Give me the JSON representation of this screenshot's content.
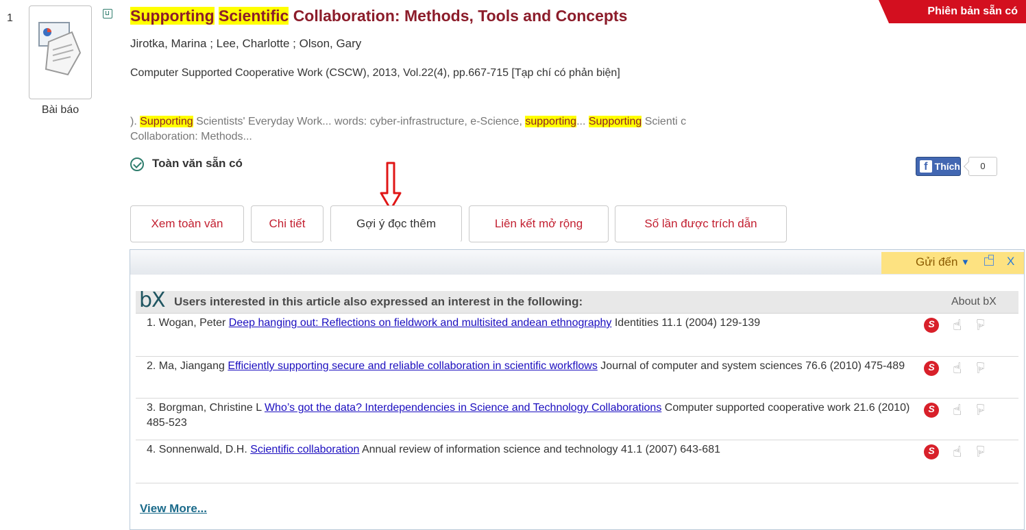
{
  "result": {
    "number": "1",
    "type_label": "Bài báo",
    "title_hl1": "Supporting",
    "title_hl2": "Scientific",
    "title_rest": "Collaboration: Methods, Tools and Concepts",
    "availability_badge": "Phiên bản sẵn có",
    "authors": "Jirotka, Marina ; Lee, Charlotte ; Olson, Gary",
    "source": "Computer Supported Cooperative Work (CSCW), 2013, Vol.22(4), pp.667-715 [Tạp chí có phản biện]",
    "snippet": {
      "p1": ").",
      "h1": "Supporting",
      "p2": "Scientists' Everyday Work... words: cyber-infrastructure, e-Science,",
      "h2": "supporting",
      "p3": "...",
      "h3": "Supporting",
      "p4": "Scienti c Collaboration: Methods..."
    },
    "fulltext_label": "Toàn văn sẵn có"
  },
  "facebook": {
    "like_label": "Thích",
    "like_count": "0",
    "logo": "f"
  },
  "tabs": [
    {
      "label": "Xem toàn văn"
    },
    {
      "label": "Chi tiết"
    },
    {
      "label": "Gợi ý đọc thêm"
    },
    {
      "label": "Liên kết mở rộng"
    },
    {
      "label": "Số lần được trích dẫn"
    }
  ],
  "panel": {
    "send_to_label": "Gửi đến",
    "close_label": "X",
    "bx": {
      "logo": "bX",
      "title": "Users interested in this article also expressed an interest in the following:",
      "about": "About bX"
    },
    "recommendations": [
      {
        "num": "1.",
        "author": "Wogan, Peter",
        "title": "Deep hanging out: Reflections on fieldwork and multisited andean ethnography",
        "rest": "Identities 11.1 (2004) 129-139"
      },
      {
        "num": "2.",
        "author": "Ma, Jiangang",
        "title": "Efficiently supporting secure and reliable collaboration in scientific workflows",
        "rest": "Journal of computer and system sciences 76.6 (2010) 475-489"
      },
      {
        "num": "3.",
        "author": "Borgman, Christine L",
        "title": "Who’s got the data? Interdependencies in Science and Technology Collaborations",
        "rest": "Computer supported cooperative work 21.6 (2010) 485-523"
      },
      {
        "num": "4.",
        "author": "Sonnenwald, D.H.",
        "title": "Scientific collaboration",
        "rest": "Annual review of information science and technology 41.1 (2007) 643-681"
      }
    ],
    "view_more": "View More..."
  },
  "icons": [
    "document-thumbnail-icon",
    "save-record-icon",
    "check-circle-icon",
    "facebook-icon",
    "down-arrow-icon",
    "popout-icon",
    "close-icon",
    "sfx-icon",
    "thumbs-up-icon",
    "thumbs-down-icon"
  ],
  "colors": {
    "title": "#8c1d2b",
    "badge": "#d30f1f",
    "highlight": "#ffff00",
    "tab_text": "#c21e2f",
    "link": "#1a0dbf",
    "send_to_bg": "#fde281"
  }
}
